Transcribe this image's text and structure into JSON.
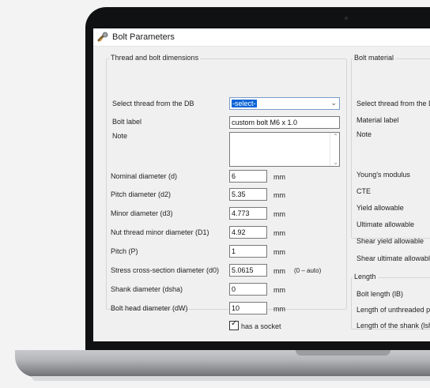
{
  "window": {
    "title": "Bolt Parameters"
  },
  "left_group": {
    "legend": "Thread and bolt dimensions",
    "select_thread_label": "Select thread from the DB",
    "select_thread_value": "-select-",
    "bolt_label_label": "Bolt label",
    "bolt_label_value": "custom bolt M6 x 1.0",
    "note_label": "Note",
    "fields": [
      {
        "label": "Nominal diameter (d)",
        "value": "6",
        "unit": "mm"
      },
      {
        "label": "Pitch diameter (d2)",
        "value": "5.35",
        "unit": "mm"
      },
      {
        "label": "Minor diameter (d3)",
        "value": "4.773",
        "unit": "mm"
      },
      {
        "label": "Nut thread minor diameter (D1)",
        "value": "4.92",
        "unit": "mm"
      },
      {
        "label": "Pitch (P)",
        "value": "1",
        "unit": "mm"
      },
      {
        "label": "Stress cross-section diameter (d0)",
        "value": "5.0615",
        "unit": "mm",
        "note": "(0 – auto)"
      },
      {
        "label": "Shank diameter (dsha)",
        "value": "0",
        "unit": "mm"
      },
      {
        "label": "Bolt head diameter (dW)",
        "value": "10",
        "unit": "mm"
      }
    ],
    "socket_label": "has a socket",
    "socket_checked": true
  },
  "right_group": {
    "legend": "Bolt material",
    "select_thread_label": "Select thread from the D",
    "material_label": "Material label",
    "note_label": "Note",
    "props": [
      "Young's modulus",
      "CTE",
      "Yield allowable",
      "Ultimate allowable",
      "Shear yield allowable",
      "Shear ultimate allowabl"
    ]
  },
  "length_group": {
    "legend": "Length",
    "items": [
      "Bolt length (lB)",
      "Length of unthreaded pa",
      "Length of the shank (lsha"
    ]
  },
  "icons": {
    "app": "bolt-wrench-icon",
    "dropdown": "chevron-down-icon",
    "scroll_up": "arrow-up-icon",
    "scroll_down": "arrow-down-icon",
    "check": "check-icon"
  }
}
